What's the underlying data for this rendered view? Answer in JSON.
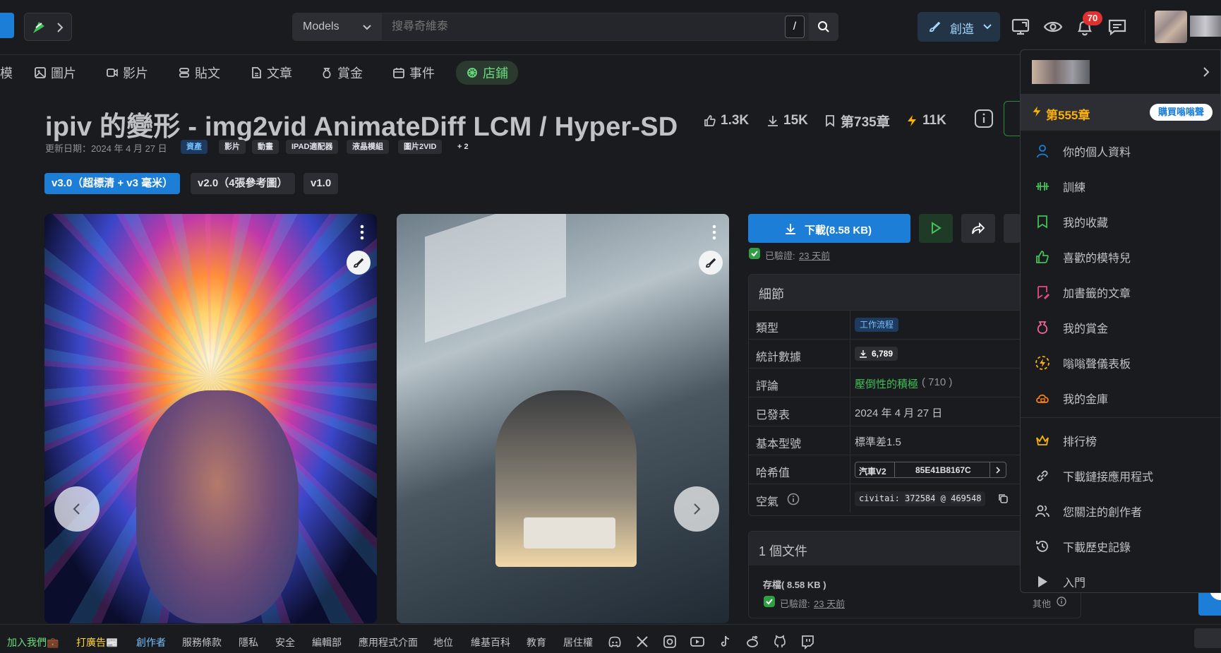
{
  "header": {
    "search_scope": "Models",
    "search_placeholder": "搜尋奇維泰",
    "search_shortcut": "/",
    "create_label": "創造",
    "notification_count": "70"
  },
  "nav": {
    "cut_item": "模",
    "items": [
      "圖片",
      "影片",
      "貼文",
      "文章",
      "賞金",
      "事件",
      "店鋪"
    ]
  },
  "model": {
    "title": "ipiv 的變形 - img2vid AnimateDiff LCM / Hyper-SD",
    "likes": "1.3K",
    "downloads": "15K",
    "rank": "第735章",
    "buzz": "11K",
    "updated": "更新日期：2024 年 4 月 27 日",
    "tags": [
      "資產",
      "影片",
      "動畫",
      "IPAD適配器",
      "液晶模組",
      "圖片2VID",
      "+ 2"
    ],
    "versions": [
      "v3.0（超標清 + v3 毫米）",
      "v2.0（4張參考圖）",
      "v1.0"
    ]
  },
  "actions": {
    "download_label": "下載(8.58 KB)",
    "verified_prefix": "已驗證:",
    "verified_when": "23 天前"
  },
  "details": {
    "heading": "細節",
    "rows": [
      {
        "label": "類型",
        "value": "工作流程"
      },
      {
        "label": "統計數據",
        "value": "6,789"
      },
      {
        "label": "評論",
        "value": "壓倒性的積極",
        "extra": "( 710 )"
      },
      {
        "label": "已發表",
        "value": "2024 年 4 月 27 日"
      },
      {
        "label": "基本型號",
        "value": "標準差1.5"
      },
      {
        "label": "哈希值",
        "value": "85E41B8167C",
        "hash_type": "汽車V2"
      },
      {
        "label": "空氣",
        "air_prefix": "civitai:",
        "air_model": "372584",
        "air_at": "@",
        "air_version": "469548"
      }
    ]
  },
  "files": {
    "heading": "1 個文件",
    "archive": "存檔( 8.58 KB )",
    "verified_prefix": "已驗證:",
    "verified_when": "23 天前",
    "other": "其他"
  },
  "menu": {
    "buzz_chapter": "第555章",
    "buy_buzz": "購買嗡嗡聲",
    "items": [
      "你的個人資料",
      "訓練",
      "我的收藏",
      "喜歡的模特兒",
      "加書籤的文章",
      "我的賞金",
      "嗡嗡聲儀表板",
      "我的金庫",
      "排行榜",
      "下載鏈接應用程式",
      "您關注的創作者",
      "下載歷史記錄",
      "入門"
    ]
  },
  "footer": {
    "links": [
      "加入我們💼",
      "打廣告📰",
      "創作者",
      "服務條款",
      "隱私",
      "安全",
      "編輯部",
      "應用程式介面",
      "地位",
      "維基百科",
      "教育",
      "居住權"
    ]
  },
  "colors": {
    "accent": "#1c7ed6",
    "success": "#40c057",
    "buzz": "#fab005",
    "danger": "#e03131"
  }
}
